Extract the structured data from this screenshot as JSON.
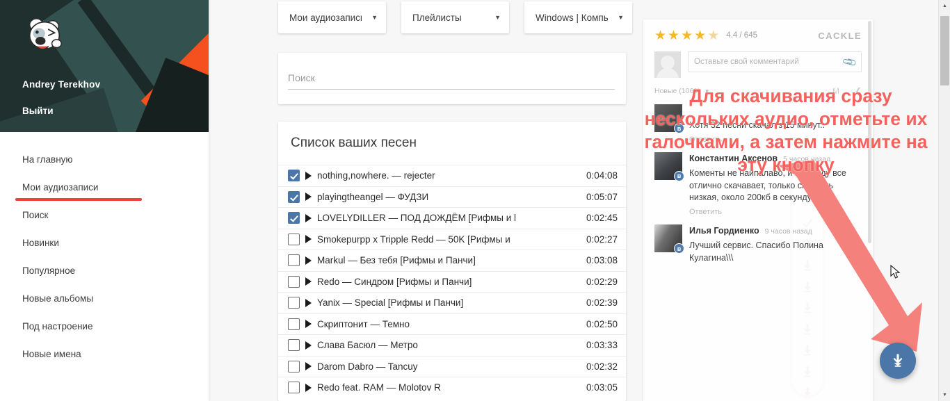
{
  "sidebar": {
    "user_name": "Andrey Terekhov",
    "logout_label": "Выйти",
    "avatar_icon": "dog-avatar-icon",
    "items": [
      {
        "label": "На главную",
        "active": false
      },
      {
        "label": "Мои аудиозаписи",
        "active": true
      },
      {
        "label": "Поиск",
        "active": false
      },
      {
        "label": "Новинки",
        "active": false
      },
      {
        "label": "Популярное",
        "active": false
      },
      {
        "label": "Новые альбомы",
        "active": false
      },
      {
        "label": "Под настроение",
        "active": false
      },
      {
        "label": "Новые имена",
        "active": false
      }
    ]
  },
  "toolbar": {
    "selects": [
      {
        "value": "Мои аудиозаписи",
        "caret": "▼"
      },
      {
        "value": "Плейлисты",
        "caret": "▼"
      },
      {
        "value": "Windows | Компь",
        "caret": "▼"
      }
    ]
  },
  "search": {
    "value": "",
    "placeholder": "Поиск"
  },
  "songlist": {
    "title": "Список ваших песен",
    "rows": [
      {
        "checked": true,
        "name": "nothing,nowhere. — rejecter",
        "duration": "0:04:08",
        "action": "check"
      },
      {
        "checked": true,
        "name": "playingtheangel — ФУДЗИ",
        "duration": "0:05:07",
        "action": "check"
      },
      {
        "checked": true,
        "name": "LOVELYDILLER — ПОД ДОЖДЁМ [Рифмы и l",
        "duration": "0:02:45",
        "action": "check"
      },
      {
        "checked": false,
        "name": "Smokepurpp x Tripple Redd — 50K [Рифмы и",
        "duration": "0:02:27",
        "action": "download"
      },
      {
        "checked": false,
        "name": "Markul — Без тебя [Рифмы и Панчи]",
        "duration": "0:03:08",
        "action": "download"
      },
      {
        "checked": false,
        "name": "Redo — Синдром [Рифмы и Панчи]",
        "duration": "0:02:29",
        "action": "download"
      },
      {
        "checked": false,
        "name": "Yanix — Special [Рифмы и Панчи]",
        "duration": "0:02:39",
        "action": "download"
      },
      {
        "checked": false,
        "name": "Скриптонит — Темно",
        "duration": "0:02:50",
        "action": "download"
      },
      {
        "checked": false,
        "name": "Слава Басюл — Метро",
        "duration": "0:03:33",
        "action": "download"
      },
      {
        "checked": false,
        "name": "Darom Dabro — Tancuy",
        "duration": "0:02:32",
        "action": "download"
      },
      {
        "checked": false,
        "name": "Redo feat. RAM — Molotov R",
        "duration": "0:03:05",
        "action": "download"
      }
    ]
  },
  "comments_panel": {
    "rating_value": "4.4 / 645",
    "stars_full": 4,
    "stars_half": 1,
    "brand": "CACKLE",
    "comment_placeholder": "Оставьте свой комментарий",
    "attach_icon": "paperclip-icon",
    "sort_label": "Новые (1060)",
    "sort_caret": "▼",
    "reply_label": "Ответить",
    "comments": [
      {
        "name": "",
        "time": "",
        "text": "Хотя 32 песни скачал з  15 минут..",
        "reply": "Ответить",
        "badge": "в"
      },
      {
        "name": "Константин Аксенов",
        "time": "5 часов назад",
        "text": "Коменты не наипалаво, и в правду все отлично скачавает, только скорость низкая, около 200кб в секунду..",
        "reply": "Ответить",
        "badge": "в"
      },
      {
        "name": "Илья Гордиенко",
        "time": "9 часов назад",
        "text": "Лучший сервис. Спасибо Полина Кулагина\\\\\\",
        "reply": "",
        "badge": "в"
      }
    ]
  },
  "annotation": {
    "line1": "Для скачивания сразу",
    "line2": "нескольких аудио, отметьте их",
    "line3": "галочками, а затем нажмите на",
    "line4": "эту кнопку",
    "color": "#f4625d"
  },
  "fab": {
    "icon": "download-icon",
    "color": "#4a76a8"
  },
  "colors": {
    "accent_red": "#e8433f",
    "vk_blue": "#4a76a8",
    "sidebar_dark": "#2e4746",
    "star_gold": "#f5b51c"
  },
  "scrollbar": {
    "up_arrow": "▲",
    "down_arrow": "▼"
  }
}
